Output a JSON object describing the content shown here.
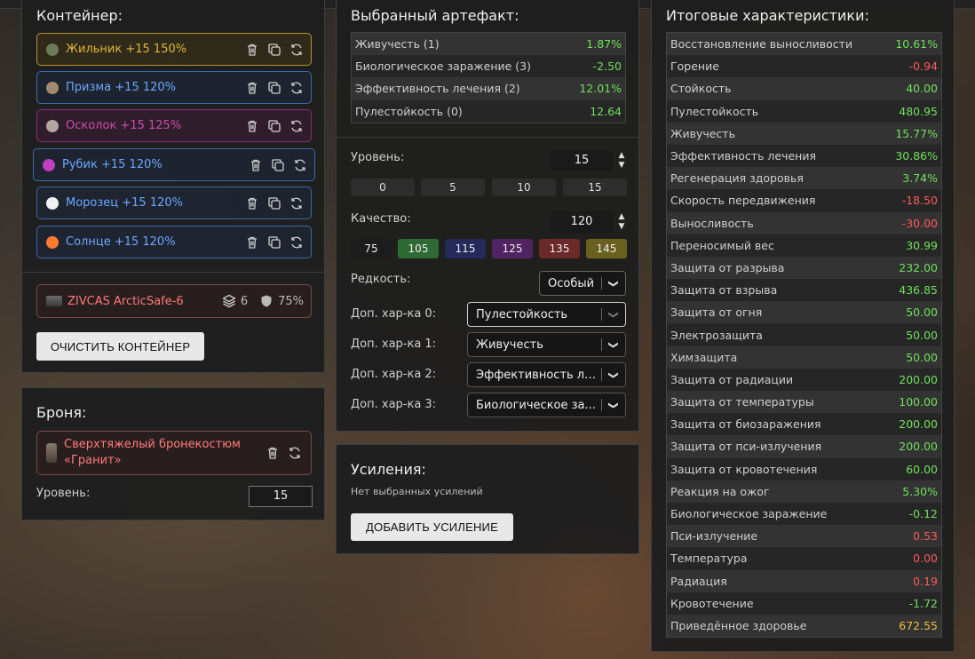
{
  "container": {
    "title": "Контейнер:",
    "artifacts": [
      {
        "name": "Жильник +15 150%",
        "color": "#e0b53a",
        "border": "#b8902a",
        "bg": "rgba(80,65,20,0.35)",
        "icon_color": "#6a7a5a"
      },
      {
        "name": "Призма +15 120%",
        "color": "#6aa8ff",
        "border": "#3a6aaa",
        "bg": "rgba(30,45,80,0.35)",
        "icon_color": "#a08a70"
      },
      {
        "name": "Осколок +15 125%",
        "color": "#d04ab0",
        "border": "#8a2a7a",
        "bg": "rgba(80,25,70,0.35)",
        "icon_color": "#b0a8a0"
      },
      {
        "name": "Рубик +15 120%",
        "color": "#6aa8ff",
        "border": "#3a6aaa",
        "bg": "rgba(30,45,80,0.35)",
        "icon_color": "#c040c0"
      },
      {
        "name": "Морозец +15 120%",
        "color": "#6aa8ff",
        "border": "#3a6aaa",
        "bg": "rgba(30,45,80,0.35)",
        "icon_color": "#f0f0f0"
      },
      {
        "name": "Солнце +15 120%",
        "color": "#6aa8ff",
        "border": "#3a6aaa",
        "bg": "rgba(30,45,80,0.35)",
        "icon_color": "#ff7a30"
      }
    ],
    "safe": {
      "name": "ZIVCAS ArcticSafe-6",
      "slots": "6",
      "protection": "75%"
    },
    "clear_button": "ОЧИСТИТЬ КОНТЕЙНЕР"
  },
  "armor": {
    "title": "Броня:",
    "name_line1": "Сверхтяжелый бронекостюм",
    "name_line2": "«Гранит»",
    "level_label": "Уровень:",
    "level_value": "15"
  },
  "selected": {
    "title": "Выбранный артефакт:",
    "stats": [
      {
        "label": "Живучесть (1)",
        "value": "1.87%",
        "kind": "pos"
      },
      {
        "label": "Биологическое заражение (3)",
        "value": "-2.50",
        "kind": "pos"
      },
      {
        "label": "Эффективность лечения (2)",
        "value": "12.01%",
        "kind": "pos"
      },
      {
        "label": "Пулестойкость (0)",
        "value": "12.64",
        "kind": "pos"
      }
    ],
    "level_label": "Уровень:",
    "level_value": "15",
    "level_presets": [
      "0",
      "5",
      "10",
      "15"
    ],
    "quality_label": "Качество:",
    "quality_value": "120",
    "quality_presets": [
      {
        "label": "75",
        "bg": "#1c1c1c"
      },
      {
        "label": "105",
        "bg": "#2f6a34"
      },
      {
        "label": "115",
        "bg": "#262a5a"
      },
      {
        "label": "125",
        "bg": "#4f2460"
      },
      {
        "label": "135",
        "bg": "#6a2a28"
      },
      {
        "label": "145",
        "bg": "#6a6020"
      }
    ],
    "rarity_label": "Редкость:",
    "rarity_value": "Особый",
    "extra_stats": [
      {
        "label": "Доп. хар-ка 0:",
        "value": "Пулестойкость"
      },
      {
        "label": "Доп. хар-ка 1:",
        "value": "Живучесть"
      },
      {
        "label": "Доп. хар-ка 2:",
        "value": "Эффективность ле..."
      },
      {
        "label": "Доп. хар-ка 3:",
        "value": "Биологическое за..."
      }
    ]
  },
  "upgrades": {
    "title": "Усиления:",
    "empty_text": "Нет выбранных усилений",
    "add_button": "ДОБАВИТЬ УСИЛЕНИЕ"
  },
  "totals": {
    "title": "Итоговые характеристики:",
    "stats": [
      {
        "label": "Восстановление выносливости",
        "value": "10.61%",
        "kind": "pos"
      },
      {
        "label": "Горение",
        "value": "-0.94",
        "kind": "neg"
      },
      {
        "label": "Стойкость",
        "value": "40.00",
        "kind": "pos"
      },
      {
        "label": "Пулестойкость",
        "value": "480.95",
        "kind": "pos"
      },
      {
        "label": "Живучесть",
        "value": "15.77%",
        "kind": "pos"
      },
      {
        "label": "Эффективность лечения",
        "value": "30.86%",
        "kind": "pos"
      },
      {
        "label": "Регенерация здоровья",
        "value": "3.74%",
        "kind": "pos"
      },
      {
        "label": "Скорость передвижения",
        "value": "-18.50",
        "kind": "neg"
      },
      {
        "label": "Выносливость",
        "value": "-30.00",
        "kind": "neg"
      },
      {
        "label": "Переносимый вес",
        "value": "30.99",
        "kind": "pos"
      },
      {
        "label": "Защита от разрыва",
        "value": "232.00",
        "kind": "pos"
      },
      {
        "label": "Защита от взрыва",
        "value": "436.85",
        "kind": "pos"
      },
      {
        "label": "Защита от огня",
        "value": "50.00",
        "kind": "pos"
      },
      {
        "label": "Электрозащита",
        "value": "50.00",
        "kind": "pos"
      },
      {
        "label": "Химзащита",
        "value": "50.00",
        "kind": "pos"
      },
      {
        "label": "Защита от радиации",
        "value": "200.00",
        "kind": "pos"
      },
      {
        "label": "Защита от температуры",
        "value": "100.00",
        "kind": "pos"
      },
      {
        "label": "Защита от биозаражения",
        "value": "200.00",
        "kind": "pos"
      },
      {
        "label": "Защита от пси-излучения",
        "value": "200.00",
        "kind": "pos"
      },
      {
        "label": "Защита от кровотечения",
        "value": "60.00",
        "kind": "pos"
      },
      {
        "label": "Реакция на ожог",
        "value": "5.30%",
        "kind": "pos"
      },
      {
        "label": "Биологическое заражение",
        "value": "-0.12",
        "kind": "pos"
      },
      {
        "label": "Пси-излучение",
        "value": "0.53",
        "kind": "neg"
      },
      {
        "label": "Температура",
        "value": "0.00",
        "kind": "neg"
      },
      {
        "label": "Радиация",
        "value": "0.19",
        "kind": "neg"
      },
      {
        "label": "Кровотечение",
        "value": "-1.72",
        "kind": "pos"
      },
      {
        "label": "Приведённое здоровье",
        "value": "672.55",
        "kind": "gold"
      }
    ]
  }
}
